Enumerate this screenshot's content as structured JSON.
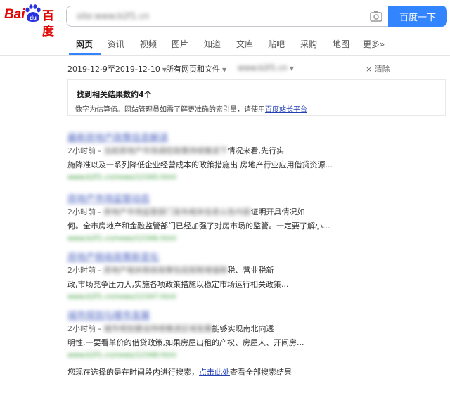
{
  "logo": {
    "bai": "Bai",
    "du": "du",
    "cn": "百度"
  },
  "search": {
    "query": "site:www.b2f1.cn",
    "button": "百度一下"
  },
  "tabs": [
    "网页",
    "资讯",
    "视频",
    "图片",
    "知道",
    "文库",
    "贴吧",
    "采购",
    "地图",
    "更多»"
  ],
  "filters": {
    "date": "2019-12-9至2019-12-10",
    "scope": "所有网页和文件",
    "site": "www.b2f1.cn",
    "clear": "清除"
  },
  "count": {
    "title": "找到相关结果数约4个",
    "note_prefix": "数字为估算值。网站管理员如需了解更准确的索引量，请使用",
    "note_link": "百度站长平台"
  },
  "results": [
    {
      "title": "最新房地产政策信息解读",
      "time": "2小时前 -",
      "line1_blur": "当前房地产市场调控政策持续推进下",
      "line1_end": "情况来看,先行实",
      "line2": "施降准以及一系列降低企业经营成本的政策措施出 房地产行业应用借贷资源...",
      "url": "www.b2f1.cn/news/12345.html"
    },
    {
      "title": "房地产市场监管动态",
      "time": "2小时前 -",
      "line1_blur": "房地产市场监管部门发布相关信息公告内容",
      "line1_end": "证明开具情况如",
      "line2": "何。全市房地产和金融监管部门已经加强了对房市场的监管。一定要了解小...",
      "url": "www.b2f1.cn/news/12346.html"
    },
    {
      "title": "房地产税收政策新变化",
      "time": "2小时前 -",
      "line1_blur": "房地产相关税收政策包括契税增值税",
      "line1_end": "税、营业税新",
      "line2": "政,市场竞争压力大,实施各项政策措施以稳定市场运行相关政策...",
      "url": "www.b2f1.cn/news/12347.html"
    },
    {
      "title": "城市规划与楼市发展",
      "time": "2小时前 -",
      "line1_blur": "城市规划建设持续推进区域发展",
      "line1_end": "能够实现南北向透",
      "line2": "明性,一要看单价的借贷政策,如果房屋出租的产权、房屋人、开间房...",
      "url": "www.b2f1.cn/news/12348.html"
    }
  ],
  "footer": {
    "prefix": "您现在选择的是在时间段内进行搜索，",
    "link": "点击此处",
    "suffix": "查看全部搜索结果"
  }
}
